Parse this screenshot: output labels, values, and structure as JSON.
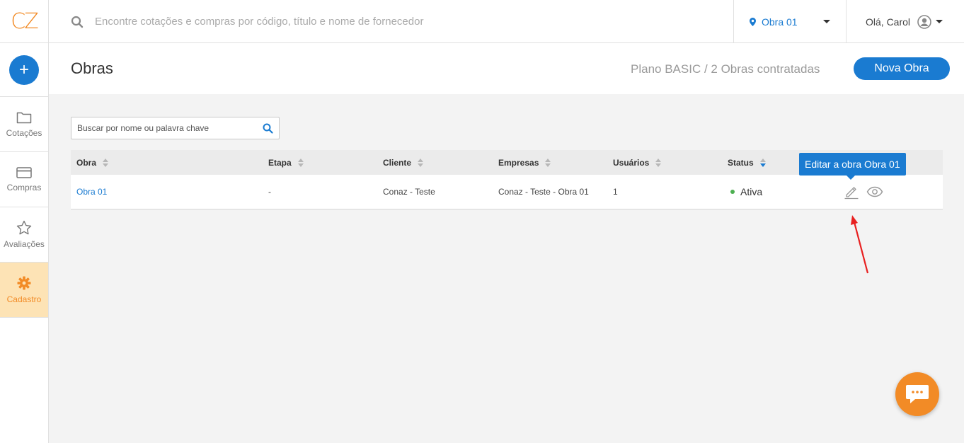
{
  "brand": {
    "logo_text": "CZ",
    "accent": "#f28b26",
    "primary": "#1a7bd1"
  },
  "topbar": {
    "search_placeholder": "Encontre cotações e compras por código, título e nome de fornecedor",
    "obra_selector": "Obra 01",
    "greeting": "Olá, Carol"
  },
  "sidebar": {
    "add_label": "+",
    "items": [
      {
        "label": "Cotações",
        "icon": "folder-icon",
        "active": false
      },
      {
        "label": "Compras",
        "icon": "credit-card-icon",
        "active": false
      },
      {
        "label": "Avaliações",
        "icon": "star-icon",
        "active": false
      },
      {
        "label": "Cadastro",
        "icon": "gear-icon",
        "active": true
      }
    ]
  },
  "header": {
    "title": "Obras",
    "plan": "Plano BASIC / 2 Obras contratadas",
    "new_button": "Nova Obra"
  },
  "filter": {
    "placeholder": "Buscar por nome ou palavra chave"
  },
  "table": {
    "columns": [
      "Obra",
      "Etapa",
      "Cliente",
      "Empresas",
      "Usuários",
      "Status"
    ],
    "rows": [
      {
        "obra": "Obra 01",
        "etapa": "-",
        "cliente": "Conaz - Teste",
        "empresas": "Conaz - Teste - Obra 01",
        "usuarios": "1",
        "status": "Ativa"
      }
    ]
  },
  "tooltip": "Editar a obra Obra 01"
}
